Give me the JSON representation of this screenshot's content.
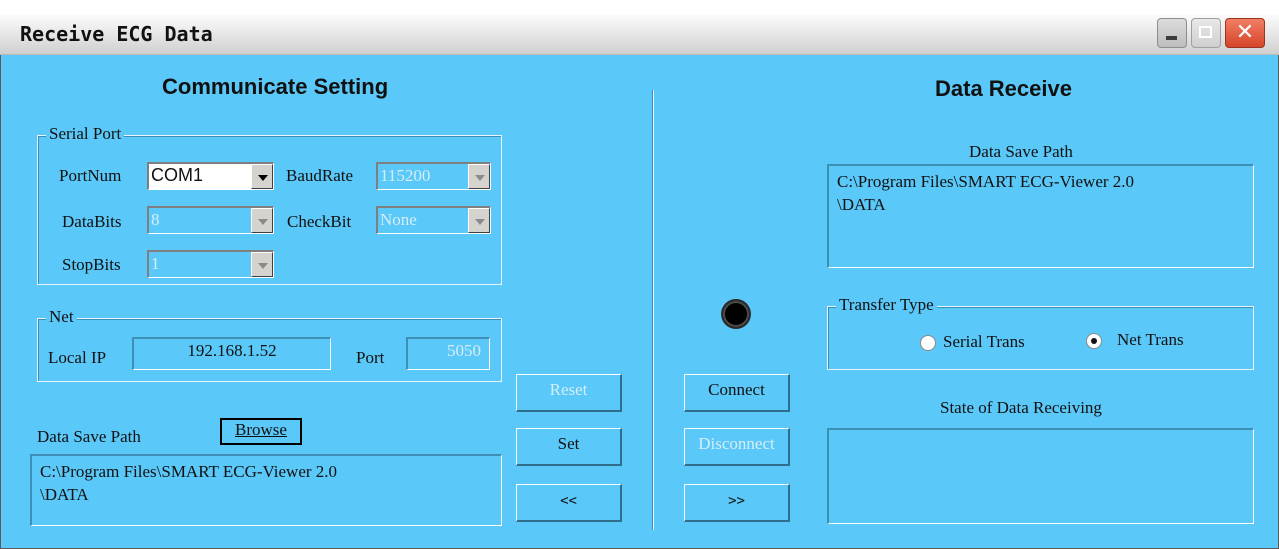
{
  "window": {
    "title": "Receive ECG Data"
  },
  "communicate": {
    "heading": "Communicate Setting",
    "serial": {
      "label": "Serial Port",
      "portnum_label": "PortNum",
      "portnum_value": "COM1",
      "baudrate_label": "BaudRate",
      "baudrate_value": "115200",
      "databits_label": "DataBits",
      "databits_value": "8",
      "checkbit_label": "CheckBit",
      "checkbit_value": "None",
      "stopbits_label": "StopBits",
      "stopbits_value": "1"
    },
    "net": {
      "label": "Net",
      "localip_label": "Local IP",
      "localip_value": "192.168.1.52",
      "port_label": "Port",
      "port_value": "5050"
    },
    "save_path": {
      "label": "Data Save Path",
      "browse_label": "Browse",
      "value_line1": "C:\\Program Files\\SMART ECG-Viewer 2.0",
      "value_line2": "\\DATA"
    }
  },
  "buttons": {
    "reset": "Reset",
    "set": "Set",
    "back": "<<",
    "connect": "Connect",
    "disconnect": "Disconnect",
    "forward": ">>"
  },
  "receive": {
    "heading": "Data Receive",
    "save_path_label": "Data Save Path",
    "save_path_line1": "C:\\Program Files\\SMART ECG-Viewer 2.0",
    "save_path_line2": "\\DATA",
    "transfer": {
      "label": "Transfer Type",
      "serial_label": "Serial Trans",
      "net_label": "Net Trans",
      "selected": "Net Trans"
    },
    "state_label": "State of Data Receiving",
    "state_value": ""
  },
  "colors": {
    "window_bg": "#5ac8f8",
    "close_button": "#d6452a"
  },
  "icons": [
    "minimize-icon",
    "maximize-icon",
    "close-icon",
    "connection-indicator-icon"
  ]
}
